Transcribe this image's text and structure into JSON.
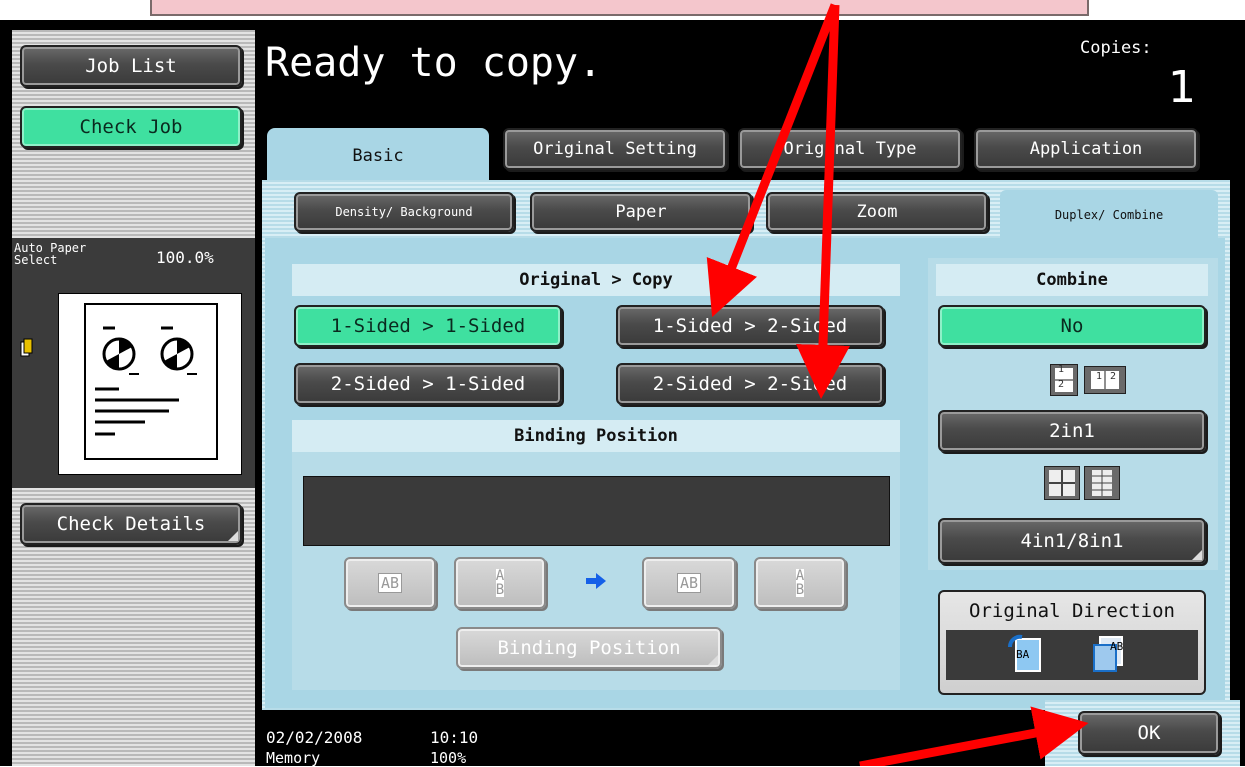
{
  "screen_title": "Ready to copy.",
  "copies": {
    "label": "Copies:",
    "value": "1"
  },
  "sidebar": {
    "job_list": "Job List",
    "check_job": "Check Job",
    "paper_select_label": "Auto Paper Select",
    "zoom_value": "100.0%",
    "check_details": "Check Details"
  },
  "tabs": {
    "basic": "Basic",
    "original_setting": "Original Setting",
    "original_type": "Original Type",
    "application": "Application"
  },
  "subtabs": {
    "density": "Density/ Background",
    "paper": "Paper",
    "zoom": "Zoom",
    "duplex": "Duplex/ Combine"
  },
  "original_copy": {
    "title": "Original > Copy",
    "opt_1_1": "1-Sided > 1-Sided",
    "opt_1_2": "1-Sided > 2-Sided",
    "opt_2_1": "2-Sided > 1-Sided",
    "opt_2_2": "2-Sided > 2-Sided",
    "selected": "1-Sided > 1-Sided"
  },
  "binding": {
    "title": "Binding Position",
    "button": "Binding Position",
    "icon_text_ab": "AB",
    "icon_text_a": "A",
    "icon_text_b": "B"
  },
  "combine": {
    "title": "Combine",
    "no": "No",
    "two_in_one": "2in1",
    "four_eight": "4in1/8in1",
    "icon_1": "1",
    "icon_2": "2",
    "selected": "No"
  },
  "original_direction": {
    "title": "Original Direction",
    "icon_text_1": "BA",
    "icon_text_2": "AB"
  },
  "ok_label": "OK",
  "status": {
    "date": "02/02/2008",
    "time": "10:10",
    "memory_label": "Memory",
    "memory_value": "100%"
  },
  "colors": {
    "selected_green": "#3fe0a0",
    "panel_blue": "#a9d6e5",
    "arrow_red": "#ff0000",
    "callout_pink": "#f4c6cc"
  }
}
